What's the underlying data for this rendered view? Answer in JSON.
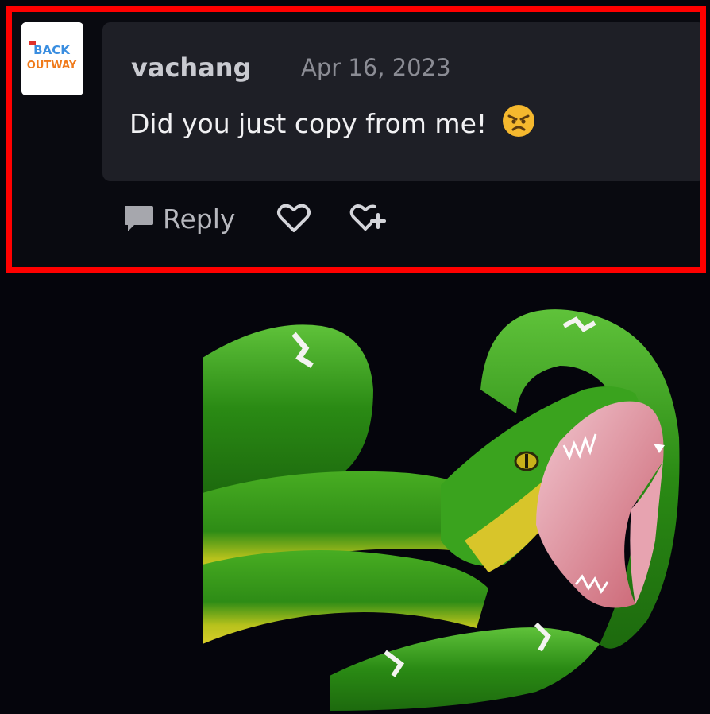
{
  "comment": {
    "author": "vachang",
    "date": "Apr 16, 2023",
    "text": "Did you just copy from me!",
    "emoji": "angry-face",
    "avatar_logo_text": "BACK OUTWAY"
  },
  "actions": {
    "reply_label": "Reply",
    "like_icon": "heart-icon",
    "react_icon": "add-reaction-icon"
  },
  "image": {
    "subject": "emerald-tree-boa-striking"
  },
  "colors": {
    "frame": "#ff0000",
    "background": "#090a10",
    "bubble": "#1e1f26",
    "snake_green": "#2f9a1c",
    "snake_yellow": "#d8d21e"
  }
}
